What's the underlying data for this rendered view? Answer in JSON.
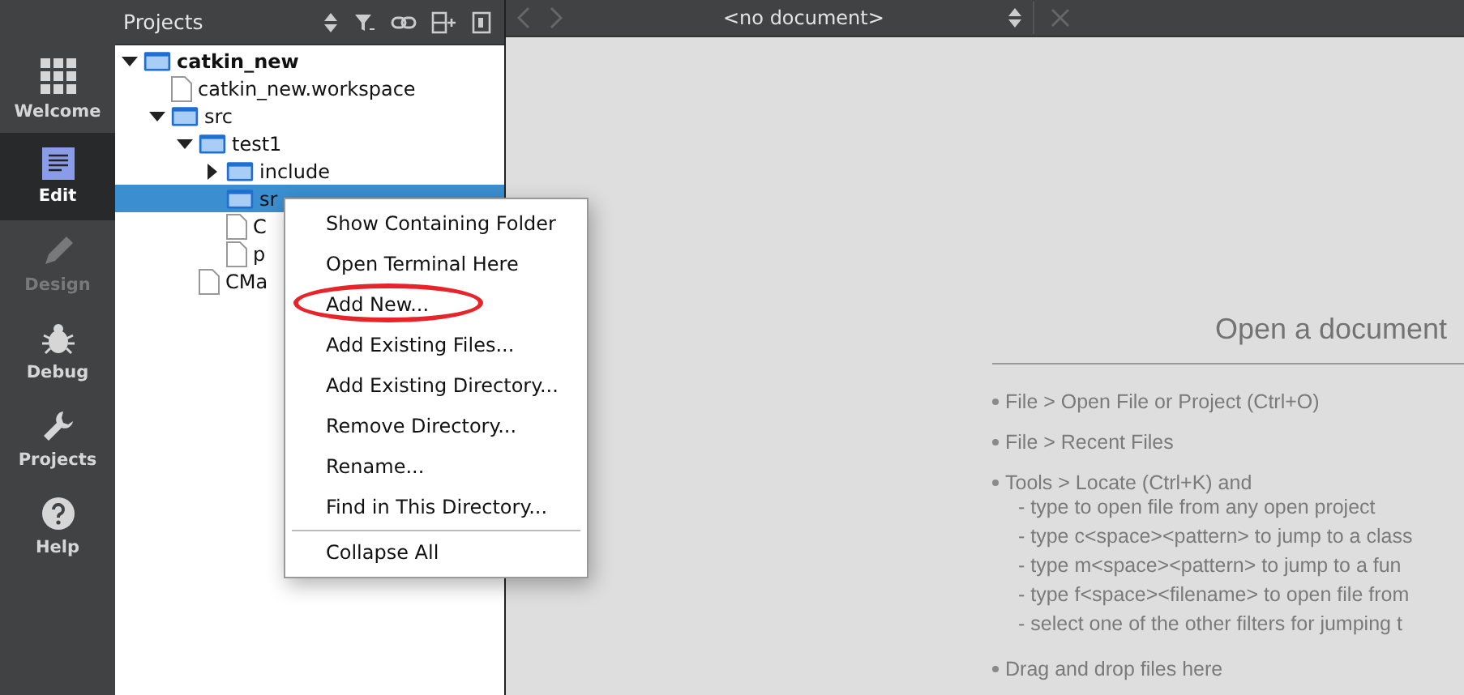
{
  "modes": [
    {
      "label": "Welcome",
      "kind": "welcome",
      "selected": false,
      "disabled": false
    },
    {
      "label": "Edit",
      "kind": "edit",
      "selected": true,
      "disabled": false
    },
    {
      "label": "Design",
      "kind": "design",
      "selected": false,
      "disabled": true
    },
    {
      "label": "Debug",
      "kind": "debug",
      "selected": false,
      "disabled": false
    },
    {
      "label": "Projects",
      "kind": "projects",
      "selected": false,
      "disabled": false
    },
    {
      "label": "Help",
      "kind": "help",
      "selected": false,
      "disabled": false
    }
  ],
  "projects_panel": {
    "title": "Projects",
    "tree": [
      {
        "name": "catkin_new",
        "kind": "project",
        "expanded": true,
        "selected": false,
        "children": [
          {
            "name": "catkin_new.workspace",
            "kind": "file",
            "selected": false
          },
          {
            "name": "src",
            "kind": "folder",
            "expanded": true,
            "selected": false,
            "children": [
              {
                "name": "test1",
                "kind": "folder",
                "expanded": true,
                "selected": false,
                "children": [
                  {
                    "name": "include",
                    "kind": "folder",
                    "expanded": false,
                    "selected": false
                  },
                  {
                    "name": "sr",
                    "kind": "folder",
                    "selected": true
                  },
                  {
                    "name": "C",
                    "kind": "file",
                    "selected": false
                  },
                  {
                    "name": "p",
                    "kind": "file",
                    "selected": false
                  }
                ]
              },
              {
                "name": "CMa",
                "kind": "file",
                "selected": false
              }
            ]
          }
        ]
      }
    ]
  },
  "editor": {
    "document": "<no document>",
    "heading": "Open a document",
    "hints": [
      {
        "text": "File > Open File or Project (Ctrl+O)"
      },
      {
        "text": "File > Recent Files"
      },
      {
        "text": "Tools > Locate (Ctrl+K) and",
        "sub": [
          "- type to open file from any open project",
          "- type c<space><pattern> to jump to a class",
          "- type m<space><pattern> to jump to a fun",
          "- type f<space><filename> to open file from",
          "- select one of the other filters for jumping t"
        ]
      },
      {
        "text": "Drag and drop files here"
      }
    ]
  },
  "context_menu": [
    {
      "kind": "item",
      "label": "Show Containing Folder",
      "highlighted": false
    },
    {
      "kind": "item",
      "label": "Open Terminal Here",
      "highlighted": false
    },
    {
      "kind": "item",
      "label": "Add New...",
      "highlighted": true
    },
    {
      "kind": "item",
      "label": "Add Existing Files...",
      "highlighted": false
    },
    {
      "kind": "item",
      "label": "Add Existing Directory...",
      "highlighted": false
    },
    {
      "kind": "item",
      "label": "Remove Directory...",
      "highlighted": false
    },
    {
      "kind": "item",
      "label": "Rename...",
      "highlighted": false
    },
    {
      "kind": "item",
      "label": "Find in This Directory...",
      "highlighted": false
    },
    {
      "kind": "separator"
    },
    {
      "kind": "item",
      "label": "Collapse All",
      "highlighted": false
    }
  ]
}
